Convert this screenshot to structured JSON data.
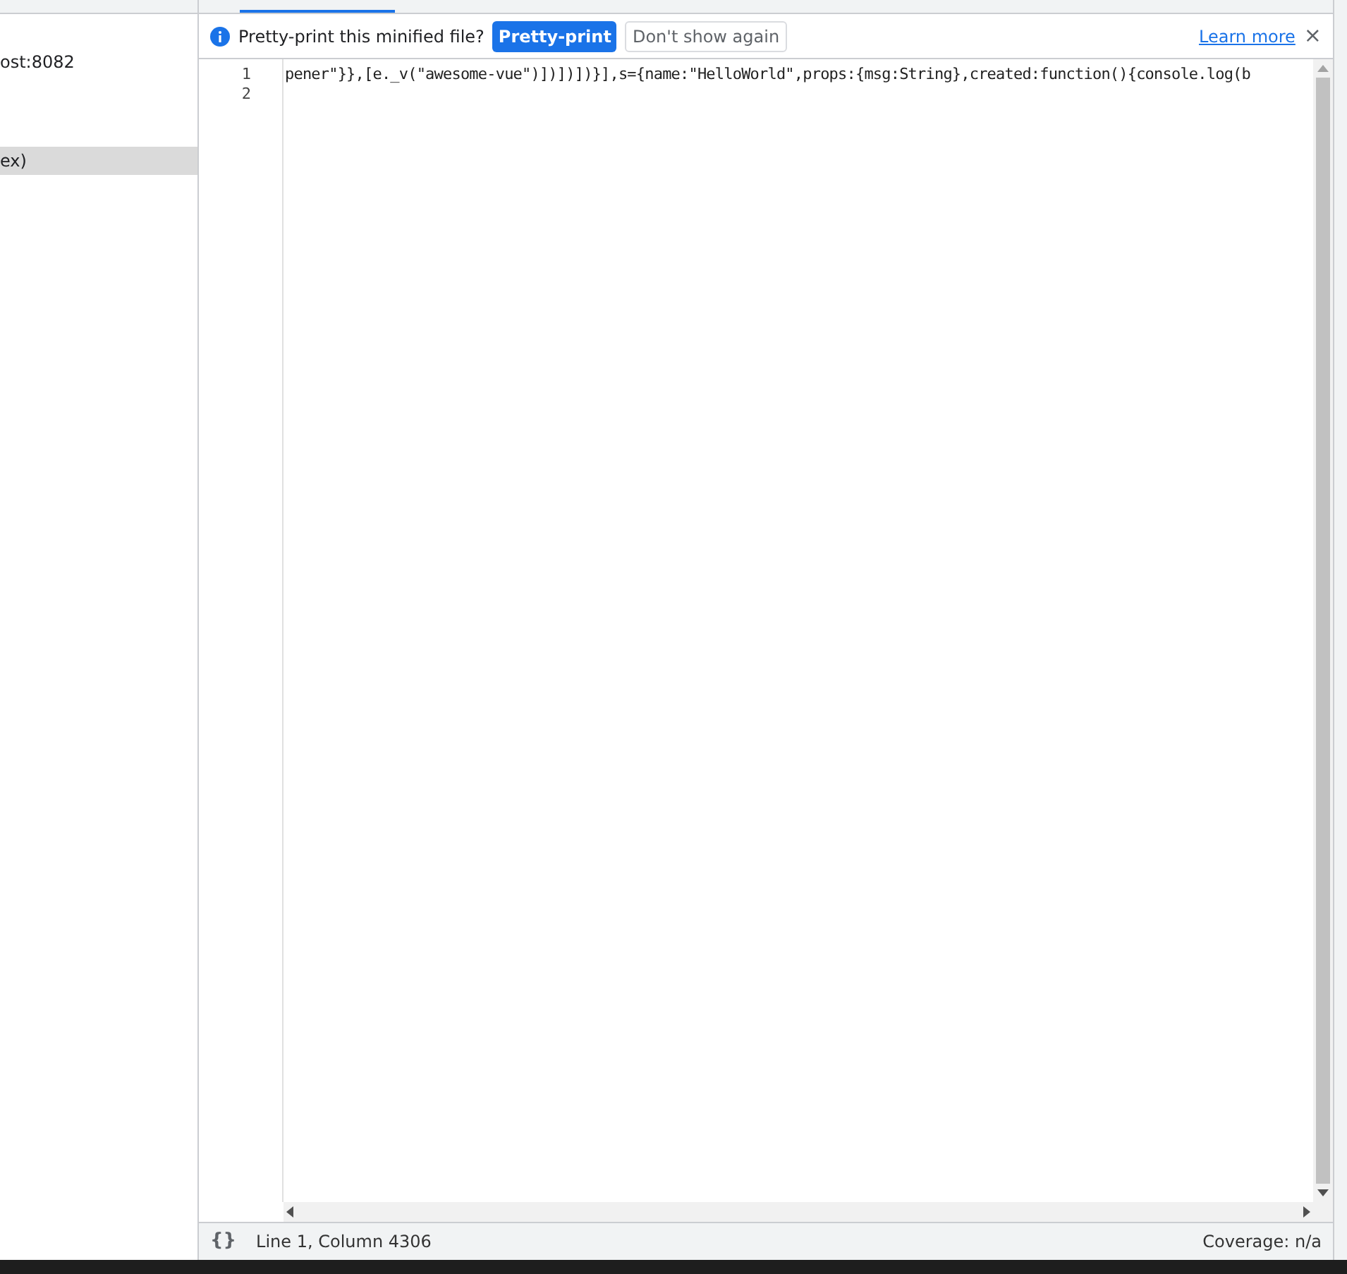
{
  "sidebar": {
    "items": [
      {
        "label": "ost:8082",
        "selected": false
      },
      {
        "label": "ex)",
        "selected": true
      }
    ]
  },
  "infobar": {
    "message": "Pretty-print this minified file?",
    "buttons": [
      {
        "label": "Pretty-print",
        "kind": "primary"
      },
      {
        "label": "Don't show again",
        "kind": "secondary"
      }
    ],
    "link": "Learn more",
    "close": "×"
  },
  "editor": {
    "lines": [
      {
        "number": "1",
        "code": "pener\"}},[e._v(\"awesome-vue\")])])])}],s={name:\"HelloWorld\",props:{msg:String},created:function(){console.log(b"
      },
      {
        "number": "2"
      }
    ]
  },
  "status_bar": {
    "format_icon": "{}",
    "position": "Line 1, Column 4306",
    "coverage": "Coverage: n/a"
  }
}
